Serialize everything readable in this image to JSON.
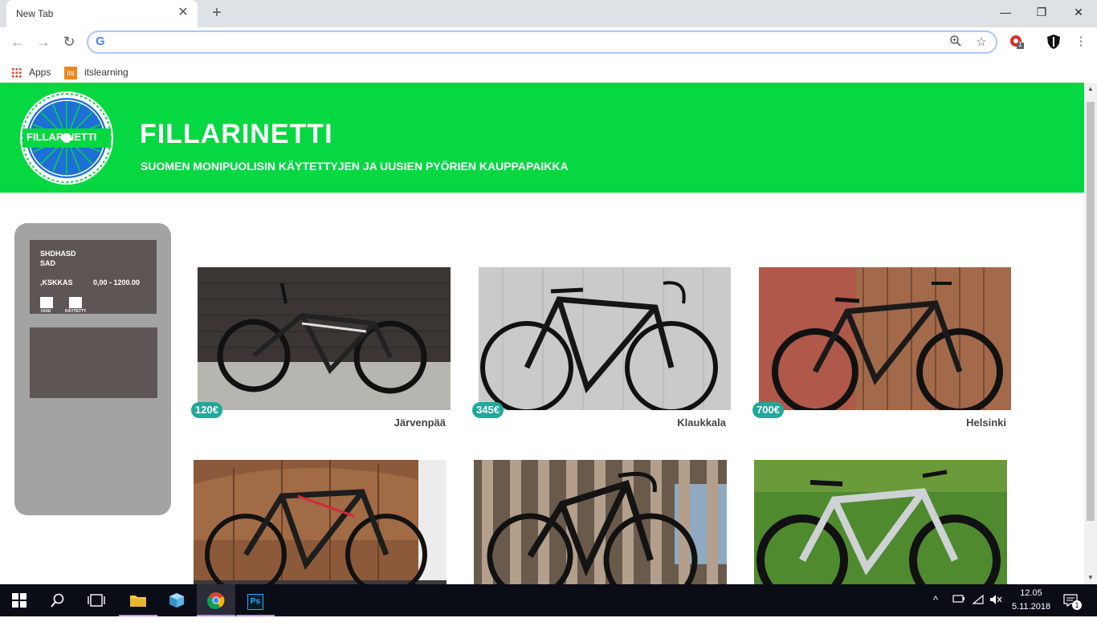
{
  "browser": {
    "tab_title": "New Tab",
    "tab_close": "✕",
    "new_tab": "+",
    "window_minimize": "—",
    "window_restore": "❐",
    "window_close": "✕",
    "back": "←",
    "forward": "→",
    "reload": "↻",
    "omnibox_value": "",
    "ext_badge": "1",
    "bookmarks": [
      {
        "label": "Apps",
        "icon": "apps-grid-icon"
      },
      {
        "label": "itslearning",
        "icon": "itslearning-icon",
        "icon_text": "its"
      }
    ]
  },
  "site": {
    "logo_text": "FILLARINETTI",
    "title": "FILLARINETTI",
    "subtitle": "SUOMEN MONIPUOLISIN KÄYTETTYJEN JA UUSIEN PYÖRIEN KAUPPAPAIKKA",
    "header_color": "#05d841"
  },
  "filter": {
    "line1": "SHDHASD",
    "line2": "SAD",
    "label": ",KSKKAS",
    "price_range": "0,00 - 1200.00",
    "checkbox_new": "UUSI",
    "checkbox_used": "KÄYTETTY"
  },
  "listings": [
    {
      "price": "120€",
      "city": "Järvenpää"
    },
    {
      "price": "345€",
      "city": "Klaukkala"
    },
    {
      "price": "700€",
      "city": "Helsinki"
    },
    {
      "price": "",
      "city": ""
    },
    {
      "price": "",
      "city": ""
    },
    {
      "price": "",
      "city": ""
    }
  ],
  "taskbar": {
    "time": "12.05",
    "date": "5.11.2018",
    "notification_count": "1",
    "photoshop_label": "Ps"
  }
}
